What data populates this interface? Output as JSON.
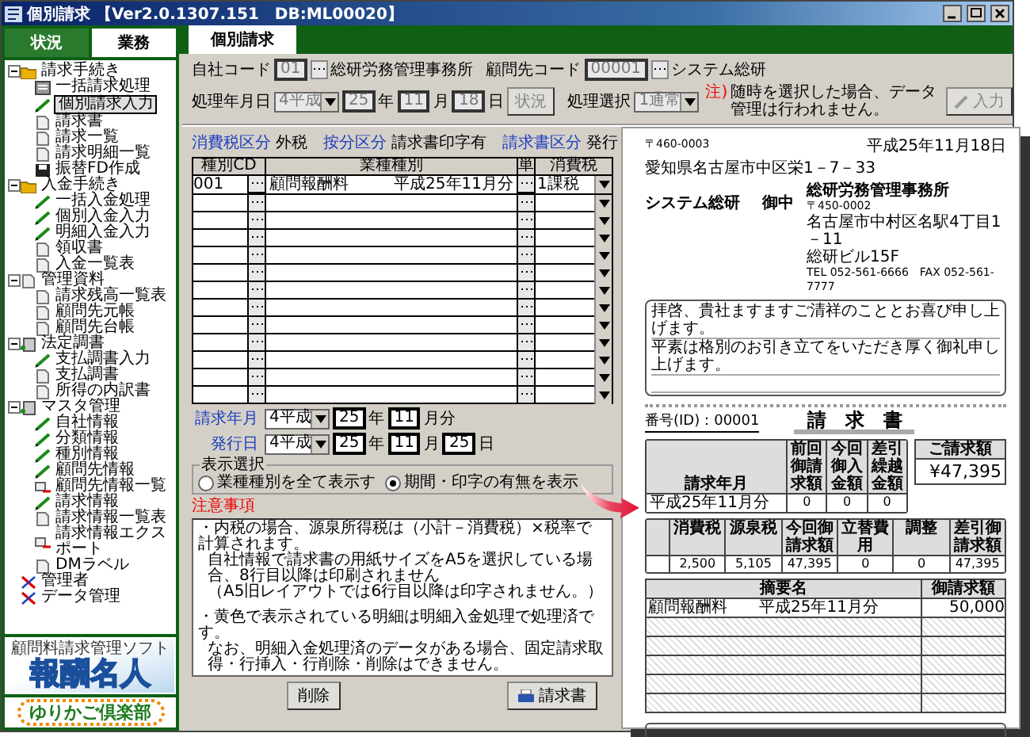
{
  "window": {
    "title": "個別請求 【Ver2.0.1307.151　DB:ML00020】"
  },
  "sidebar": {
    "tabs": [
      {
        "label": "状況",
        "selected": false
      },
      {
        "label": "業務",
        "selected": true
      }
    ],
    "tree": [
      {
        "label": "請求手続き",
        "kind": "folder",
        "selected": false,
        "expanded": true,
        "children": [
          {
            "label": "一括請求処理",
            "kind": "form",
            "selected": false
          },
          {
            "label": "個別請求入力",
            "kind": "pencil",
            "selected": true
          },
          {
            "label": "請求書",
            "kind": "doc",
            "selected": false
          },
          {
            "label": "請求一覧",
            "kind": "doc",
            "selected": false
          },
          {
            "label": "請求明細一覧",
            "kind": "doc",
            "selected": false
          },
          {
            "label": "振替FD作成",
            "kind": "disk",
            "selected": false
          }
        ]
      },
      {
        "label": "入金手続き",
        "kind": "folder",
        "selected": false,
        "expanded": true,
        "children": [
          {
            "label": "一括入金処理",
            "kind": "pencil",
            "selected": false
          },
          {
            "label": "個別入金入力",
            "kind": "pencil",
            "selected": false
          },
          {
            "label": "明細入金入力",
            "kind": "pencil",
            "selected": false
          },
          {
            "label": "領収書",
            "kind": "doc",
            "selected": false
          },
          {
            "label": "入金一覧表",
            "kind": "doc",
            "selected": false
          }
        ]
      },
      {
        "label": "管理資料",
        "kind": "doc",
        "selected": false,
        "expanded": true,
        "children": [
          {
            "label": "請求残高一覧表",
            "kind": "doc",
            "selected": false
          },
          {
            "label": "顧問先元帳",
            "kind": "doc",
            "selected": false
          },
          {
            "label": "顧問先台帳",
            "kind": "doc",
            "selected": false
          }
        ]
      },
      {
        "label": "法定調書",
        "kind": "book",
        "selected": false,
        "expanded": true,
        "children": [
          {
            "label": "支払調書入力",
            "kind": "pencil",
            "selected": false
          },
          {
            "label": "支払調書",
            "kind": "doc",
            "selected": false
          },
          {
            "label": "所得の内訳書",
            "kind": "doc",
            "selected": false
          }
        ]
      },
      {
        "label": "マスタ管理",
        "kind": "book",
        "selected": false,
        "expanded": true,
        "children": [
          {
            "label": "自社情報",
            "kind": "pencil",
            "selected": false
          },
          {
            "label": "分類情報",
            "kind": "pencil",
            "selected": false
          },
          {
            "label": "種別情報",
            "kind": "pencil",
            "selected": false
          },
          {
            "label": "顧問先情報",
            "kind": "pencil",
            "selected": false
          },
          {
            "label": "顧問先情報一覧",
            "kind": "export",
            "selected": false
          },
          {
            "label": "請求情報",
            "kind": "pencil",
            "selected": false
          },
          {
            "label": "請求情報一覧表",
            "kind": "doc",
            "selected": false
          },
          {
            "label": "請求情報エクスポート",
            "kind": "export",
            "selected": false
          },
          {
            "label": "DMラベル",
            "kind": "doc",
            "selected": false
          }
        ]
      },
      {
        "label": "管理者",
        "kind": "tools",
        "selected": false
      },
      {
        "label": "データ管理",
        "kind": "tools",
        "selected": false
      }
    ],
    "brand_logo": {
      "caption": "顧問料請求管理ソフト",
      "title": "報酬名人"
    },
    "club_logo": {
      "title": "ゆりかご倶楽部"
    }
  },
  "tab": {
    "label": "個別請求",
    "selected": true
  },
  "form": {
    "rows": [
      {
        "parts": [
          {
            "kind": "label",
            "value": "自社コード"
          },
          {
            "kind": "field",
            "value": "01",
            "disabled": true
          },
          {
            "kind": "lookup"
          },
          {
            "kind": "text",
            "value": "総研労務管理事務所"
          },
          {
            "kind": "label",
            "value": "顧問先コード"
          },
          {
            "kind": "field",
            "value": "00001",
            "disabled": true
          },
          {
            "kind": "lookup"
          },
          {
            "kind": "text",
            "value": "システム総研"
          }
        ]
      },
      {
        "parts": [
          {
            "kind": "label",
            "value": "処理年月日"
          },
          {
            "kind": "select",
            "value": "4平成",
            "disabled": true
          },
          {
            "kind": "field",
            "value": "25",
            "disabled": true
          },
          {
            "kind": "unit",
            "value": "年"
          },
          {
            "kind": "field",
            "value": "11",
            "disabled": true
          },
          {
            "kind": "unit",
            "value": "月"
          },
          {
            "kind": "field",
            "value": "18",
            "disabled": true
          },
          {
            "kind": "unit",
            "value": "日"
          },
          {
            "kind": "button",
            "value": "状況",
            "disabled": true
          },
          {
            "kind": "label",
            "value": "処理選択"
          },
          {
            "kind": "select",
            "value": "1通常",
            "disabled": true
          },
          {
            "kind": "warning",
            "mark": "注)",
            "value": "随時を選択した場合、データ管理は行われません。"
          },
          {
            "kind": "edit_button",
            "value": "入力",
            "disabled": true
          }
        ]
      }
    ],
    "info": [
      {
        "label": "消費税区分",
        "value": "外税"
      },
      {
        "label": "按分区分",
        "value": "請求書印字有"
      },
      {
        "label": "請求書区分",
        "value": "発行"
      }
    ]
  },
  "table": {
    "columns": [
      "種別CD",
      "業種種別",
      "単",
      "消費税"
    ],
    "rows": [
      {
        "code": "001",
        "item": "顧問報酬料",
        "period": "平成25年11月分",
        "tax": "1課税"
      },
      {},
      {},
      {},
      {},
      {},
      {},
      {},
      {},
      {},
      {},
      {},
      {}
    ]
  },
  "billing": {
    "rows": [
      {
        "parts": [
          {
            "kind": "heading",
            "value": "請求年月"
          },
          {
            "kind": "select",
            "value": "4平成",
            "disabled": false
          },
          {
            "kind": "field",
            "value": "25",
            "disabled": false
          },
          {
            "kind": "unit",
            "value": "年"
          },
          {
            "kind": "field",
            "value": "11",
            "disabled": false
          },
          {
            "kind": "unit",
            "value": "月分"
          }
        ]
      },
      {
        "parts": [
          {
            "kind": "heading",
            "value": "発行日"
          },
          {
            "kind": "select",
            "value": "4平成",
            "disabled": false
          },
          {
            "kind": "field",
            "value": "25",
            "disabled": false
          },
          {
            "kind": "unit",
            "value": "年"
          },
          {
            "kind": "field",
            "value": "11",
            "disabled": false
          },
          {
            "kind": "unit",
            "value": "月"
          },
          {
            "kind": "field",
            "value": "25",
            "disabled": false
          },
          {
            "kind": "unit",
            "value": "日"
          }
        ]
      }
    ],
    "display_select": {
      "title": "表示選択",
      "options": [
        {
          "label": "業種種別を全て表示す",
          "selected": false
        },
        {
          "label": "期間・印字の有無を表示",
          "selected": true
        }
      ]
    }
  },
  "notes": {
    "title": "注意事項",
    "lines": [
      "・内税の場合、源泉所得税は（小計－消費税）×税率で計算されます。",
      "自社情報で請求書の用紙サイズをA5を選択している場合、8行目以降は印刷されません",
      "（A5旧レイアウトでは6行目以降は印字されません。）",
      "・黄色で表示されている明細は明細入金処理で処理済です。",
      "なお、明細入金処理済のデータがある場合、固定請求取得・行挿入・行削除・削除はできません。"
    ]
  },
  "buttons": [
    {
      "label": "削除",
      "kind": "plain"
    },
    {
      "label": "請求書",
      "kind": "print"
    }
  ],
  "document": {
    "postal": "〒460-0003",
    "date": "平成25年11月18日",
    "address": "愛知県名古屋市中区栄1－7－33",
    "recipient": "システム総研",
    "honorific": "御中",
    "sender": [
      {
        "kind": "name",
        "text": "総研労務管理事務所"
      },
      {
        "kind": "small",
        "text": "〒450-0002"
      },
      {
        "kind": "line",
        "text": "名古屋市中村区名駅4丁目1－11"
      },
      {
        "kind": "line",
        "text": "総研ビル15F"
      },
      {
        "kind": "small",
        "text": "TEL 052-561-6666　FAX 052-561-7777"
      }
    ],
    "greeting": [
      "拝啓、貴社ますますご清祥のこととお喜び申し上げます。",
      "平素は格別のお引き立てをいただき厚く御礼申し上げます。"
    ],
    "number": "番号(ID)：00001",
    "title": "請　求　書",
    "summary": [
      {
        "label": "請求年月",
        "value": "平成25年11月分"
      },
      {
        "label": "前回御請求額",
        "value": "0"
      },
      {
        "label": "今回御入金額",
        "value": "0"
      },
      {
        "label": "差引繰越金額",
        "value": "0"
      }
    ],
    "total": {
      "label": "ご請求額",
      "value": "¥47,395"
    },
    "breakdown": [
      {
        "label": "消費税",
        "value": "2,500"
      },
      {
        "label": "源泉税",
        "value": "5,105"
      },
      {
        "label": "今回御請求額",
        "value": "47,395"
      },
      {
        "label": "立替費用",
        "value": "0"
      },
      {
        "label": "調整",
        "value": "0"
      },
      {
        "label": "差引御請求額",
        "value": "47,395"
      }
    ],
    "details": {
      "columns": [
        "摘要名",
        "御請求額"
      ],
      "rows": [
        {
          "item": "顧問報酬料",
          "period": "平成25年11月分",
          "amount": "50,000"
        },
        {},
        {},
        {},
        {},
        {}
      ]
    }
  }
}
